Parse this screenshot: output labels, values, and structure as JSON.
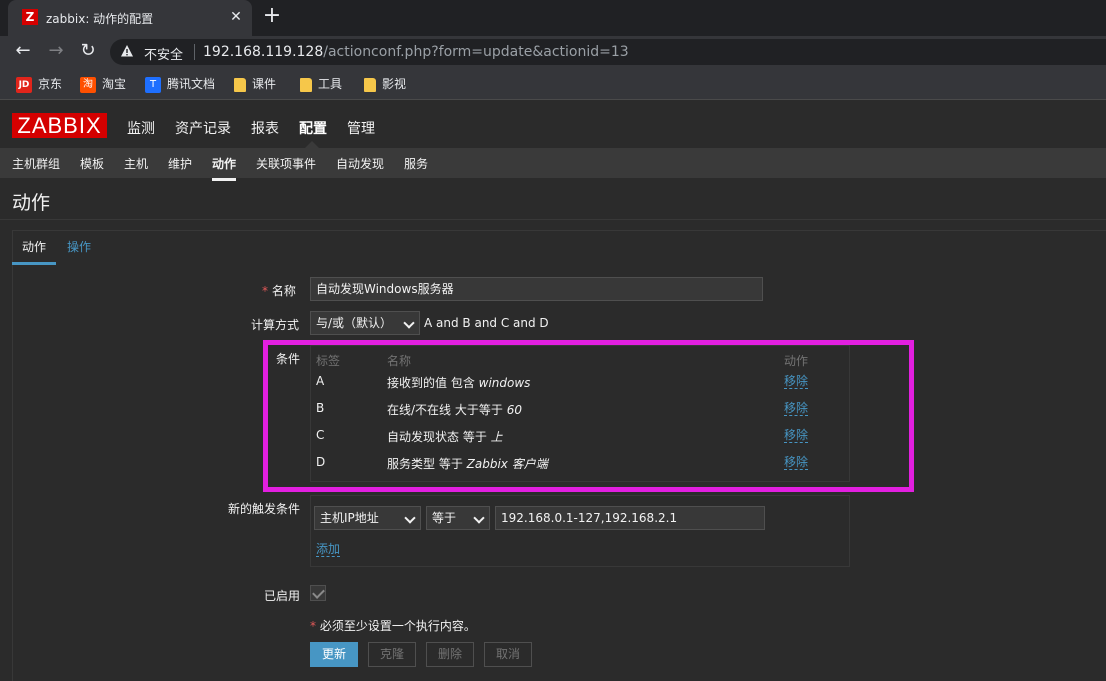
{
  "browser": {
    "tab_title": "zabbix: 动作的配置",
    "favicon_letter": "Z",
    "insecure_label": "不安全",
    "url_host": "192.168.119.128",
    "url_path": "/actionconf.php?form=update&actionid=13",
    "bookmarks": [
      {
        "label": "京东",
        "icon": "jd-icon"
      },
      {
        "label": "淘宝",
        "icon": "taobao-icon"
      },
      {
        "label": "腾讯文档",
        "icon": "tencent-docs-icon"
      },
      {
        "label": "课件",
        "icon": "folder-icon"
      },
      {
        "label": "工具",
        "icon": "folder-icon"
      },
      {
        "label": "影视",
        "icon": "folder-icon"
      }
    ]
  },
  "header": {
    "logo": "ZABBIX",
    "main_menu": [
      "监测",
      "资产记录",
      "报表",
      "配置",
      "管理"
    ],
    "active_main": "配置",
    "sub_menu": [
      "主机群组",
      "模板",
      "主机",
      "维护",
      "动作",
      "关联项事件",
      "自动发现",
      "服务"
    ],
    "active_sub": "动作"
  },
  "page": {
    "title": "动作",
    "tabs": [
      "动作",
      "操作"
    ],
    "active_tab": "动作"
  },
  "form": {
    "name_label": "名称",
    "name_value": "自动发现Windows服务器",
    "calc_label": "计算方式",
    "calc_value": "与/或（默认）",
    "calc_expression": "A and B and C and D",
    "conditions_label": "条件",
    "conditions_headers": [
      "标签",
      "名称",
      "动作"
    ],
    "conditions": [
      {
        "tag": "A",
        "name_prefix": "接收到的值 包含 ",
        "name_value": "windows",
        "action": "移除"
      },
      {
        "tag": "B",
        "name_prefix": "在线/不在线 大于等于 ",
        "name_value": "60",
        "action": "移除"
      },
      {
        "tag": "C",
        "name_prefix": "自动发现状态 等于 ",
        "name_value": "上",
        "action": "移除"
      },
      {
        "tag": "D",
        "name_prefix": "服务类型 等于 ",
        "name_value": "Zabbix 客户端",
        "action": "移除"
      }
    ],
    "new_condition_label": "新的触发条件",
    "new_condition_type": "主机IP地址",
    "new_condition_operator": "等于",
    "new_condition_value": "192.168.0.1-127,192.168.2.1",
    "add_link": "添加",
    "enabled_label": "已启用",
    "enabled": true,
    "required_note": "必须至少设置一个执行内容。",
    "buttons": {
      "update": "更新",
      "clone": "克隆",
      "delete": "删除",
      "cancel": "取消"
    }
  },
  "colors": {
    "accent": "#4796c4",
    "highlight": "#e21fe0",
    "brand": "#d40000"
  }
}
